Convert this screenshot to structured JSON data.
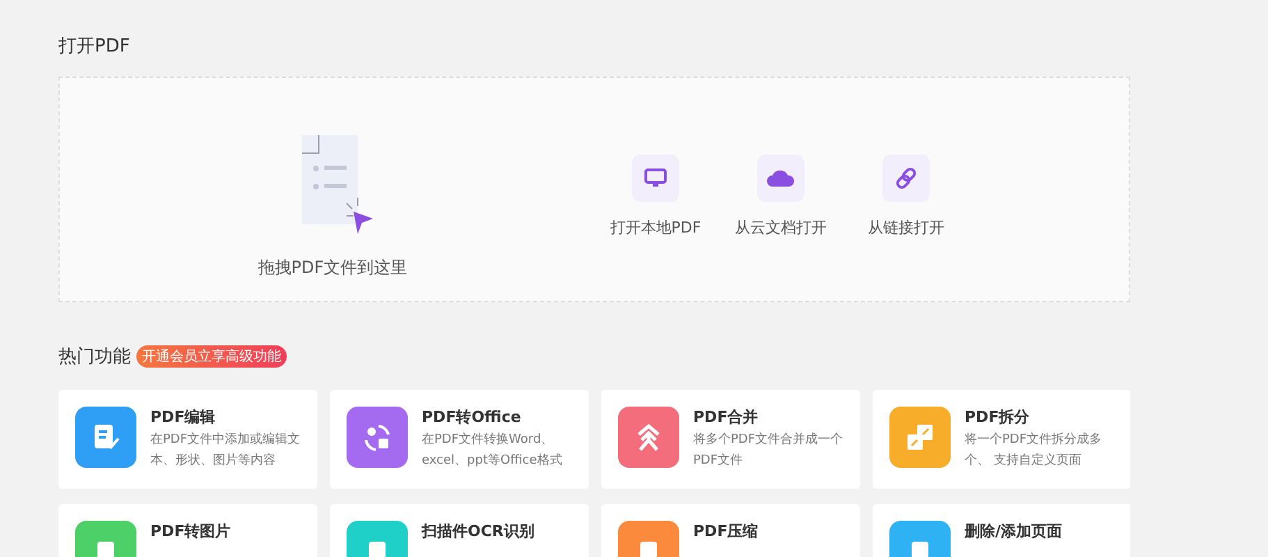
{
  "open_section": {
    "title": "打开PDF",
    "drop_hint": "拖拽PDF文件到这里",
    "options": [
      {
        "kind": "local",
        "label": "打开本地PDF"
      },
      {
        "kind": "cloud",
        "label": "从云文档打开"
      },
      {
        "kind": "link",
        "label": "从链接打开"
      }
    ]
  },
  "features": {
    "title": "热门功能",
    "badge": "开通会员立享高级功能",
    "items": [
      {
        "kind": "edit",
        "color": "#2f9ff5",
        "title": "PDF编辑",
        "description": "在PDF文件中添加或编辑文本、形状、图片等内容"
      },
      {
        "kind": "convert",
        "color": "#a46af0",
        "title": "PDF转Office",
        "description": "在PDF文件转换Word、excel、ppt等Office格式"
      },
      {
        "kind": "merge",
        "color": "#f36d7c",
        "title": "PDF合并",
        "description": "将多个PDF文件合并成一个PDF文件"
      },
      {
        "kind": "split",
        "color": "#f8ad2a",
        "title": "PDF拆分",
        "description": "将一个PDF文件拆分成多个、 支持自定义页面"
      },
      {
        "kind": "image",
        "color": "#4cd067",
        "title": "PDF转图片"
      },
      {
        "kind": "ocr",
        "color": "#1fd0c8",
        "title": "扫描件OCR识别"
      },
      {
        "kind": "compress",
        "color": "#fb8a3c",
        "title": "PDF压缩"
      },
      {
        "kind": "pages",
        "color": "#2fb2f4",
        "title": "删除/添加页面"
      }
    ]
  }
}
